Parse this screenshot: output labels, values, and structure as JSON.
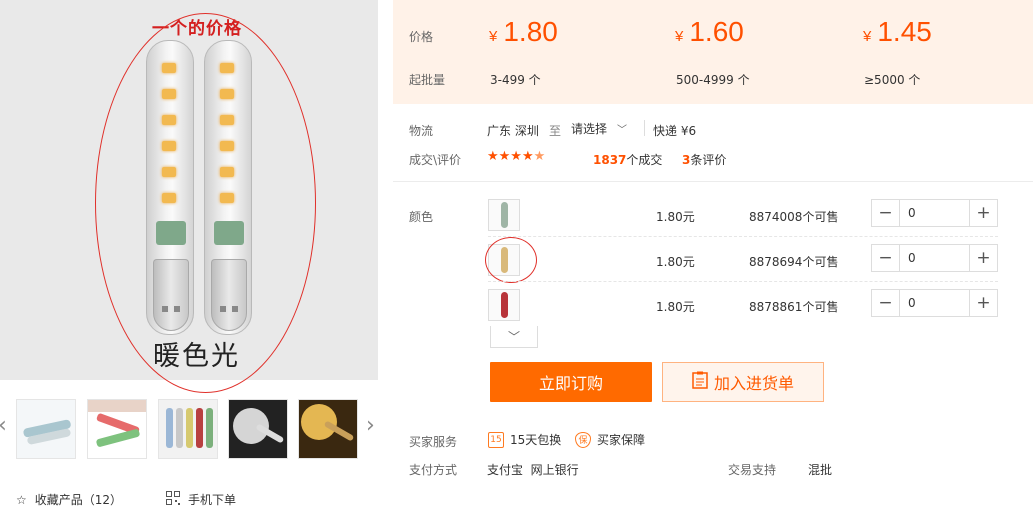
{
  "product_image": {
    "caption_top": "一个的价格",
    "caption_bottom": "暖色光"
  },
  "thumbnails": [
    {
      "name": "thumb-1"
    },
    {
      "name": "thumb-2"
    },
    {
      "name": "thumb-3"
    },
    {
      "name": "thumb-4"
    },
    {
      "name": "thumb-5"
    }
  ],
  "bottom_links": {
    "favorite": "收藏产品（12）",
    "mobile": "手机下单"
  },
  "price_bar": {
    "price_label": "价格",
    "moq_label": "起批量",
    "currency": "¥",
    "tiers": [
      {
        "price": "1.80",
        "range": "3-499 个"
      },
      {
        "price": "1.60",
        "range": "500-4999 个"
      },
      {
        "price": "1.45",
        "range": "≥5000 个"
      }
    ]
  },
  "logistics": {
    "label": "物流",
    "origin": "广东 深圳",
    "to": "至",
    "destination": "请选择",
    "shipping": "快递 ¥6"
  },
  "reviews": {
    "label": "成交\\评价",
    "rating_of_5": 4.5,
    "deals_count": "1837",
    "deals_suffix": "个成交",
    "review_count": "3",
    "review_suffix": "条评价"
  },
  "color": {
    "label": "颜色",
    "options": [
      {
        "price": "1.80元",
        "stock": "8874008个可售",
        "qty": "0",
        "swatch": "#9fb5a6"
      },
      {
        "price": "1.80元",
        "stock": "8878694个可售",
        "qty": "0",
        "swatch": "#d9b97a"
      },
      {
        "price": "1.80元",
        "stock": "8878861个可售",
        "qty": "0",
        "swatch": "#b8343a"
      }
    ]
  },
  "actions": {
    "order": "立即订购",
    "add_cart": "加入进货单"
  },
  "services": {
    "label": "买家服务",
    "exchange": "15天包换",
    "exchange_icon": "15",
    "guarantee": "买家保障",
    "guarantee_icon": "保"
  },
  "payment": {
    "label": "支付方式",
    "methods": "支付宝  网上银行",
    "trade_label": "交易支持",
    "trade_value": "混批"
  },
  "colors": {
    "accent": "#ff5000",
    "price_bg": "#fff2e8"
  }
}
